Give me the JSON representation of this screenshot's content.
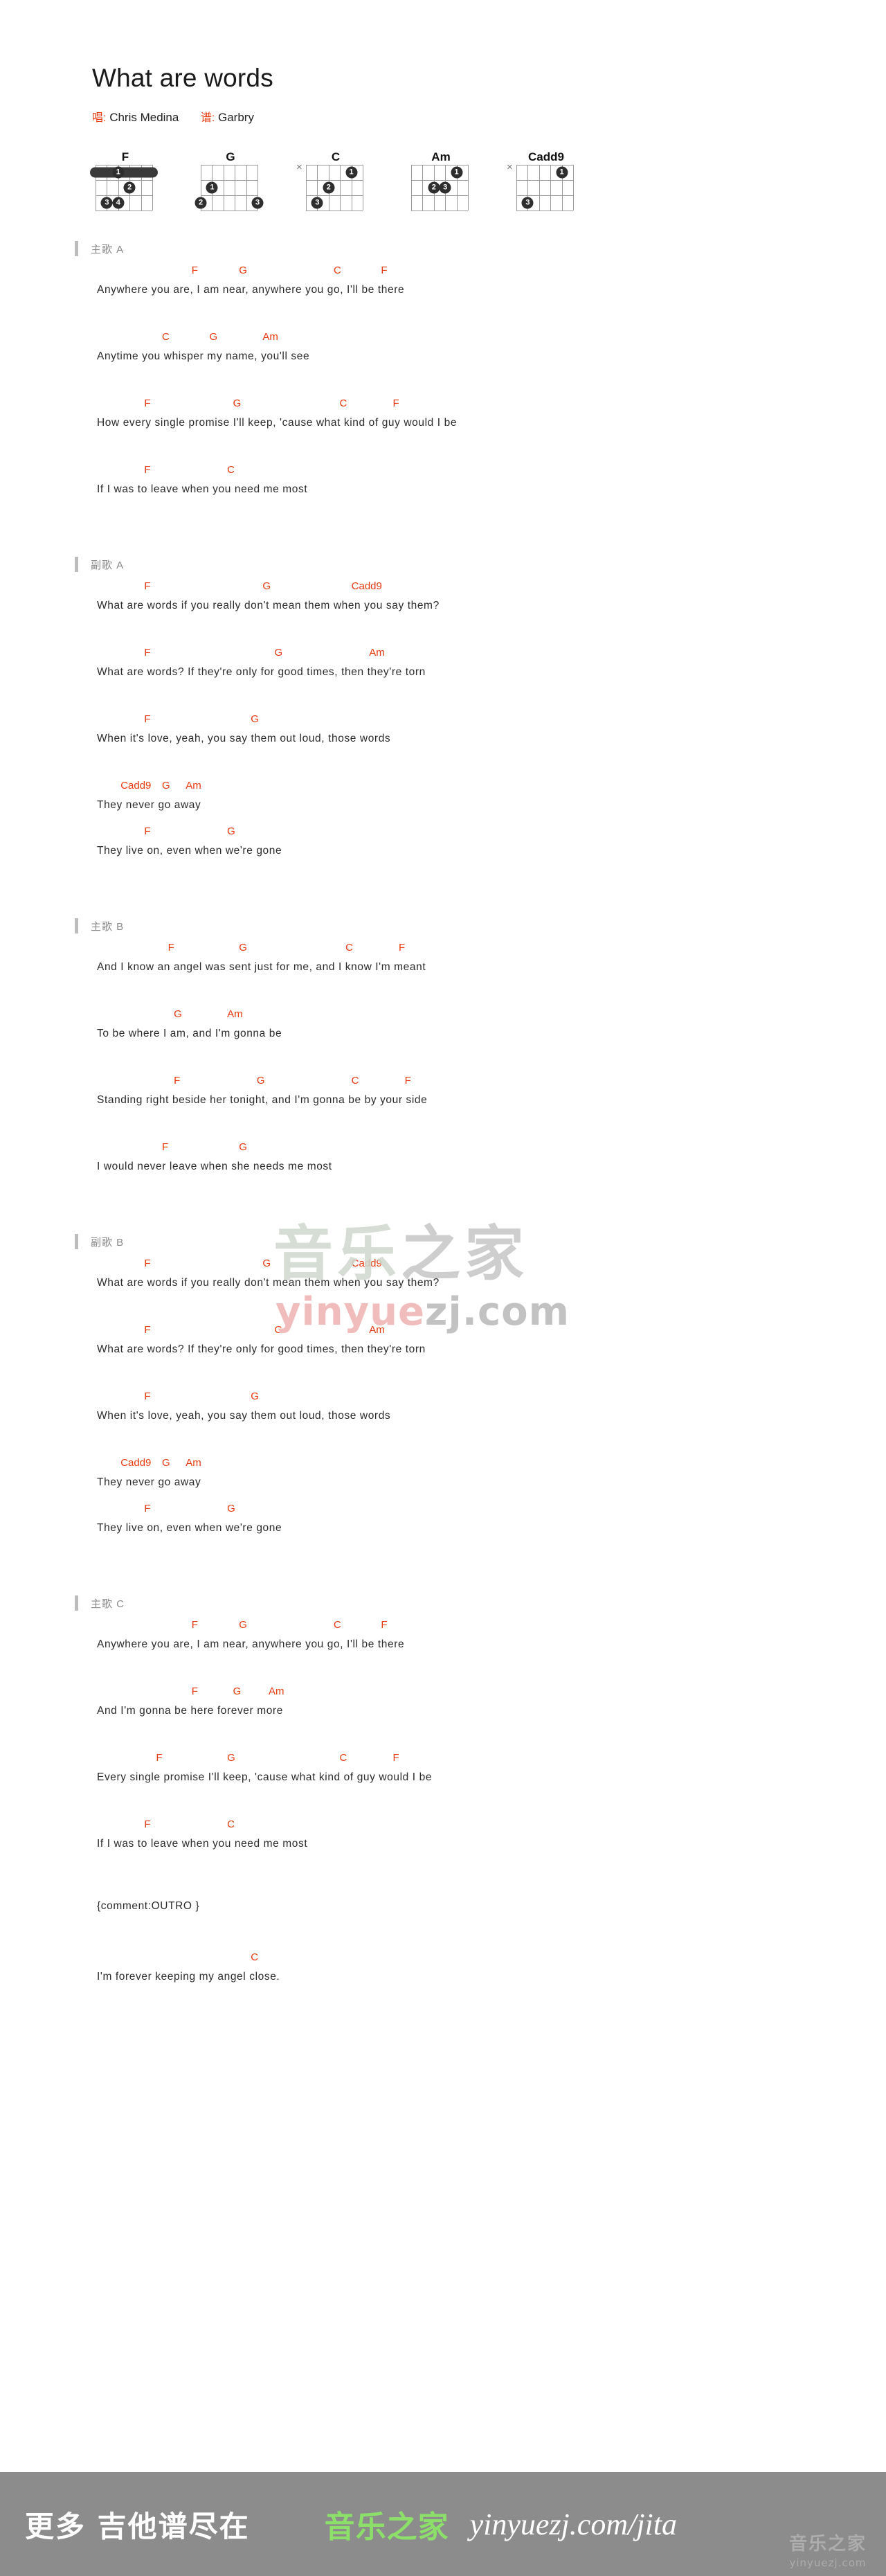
{
  "header": {
    "title": "What are words",
    "singer_label": "唱:",
    "singer": "Chris Medina",
    "transcriber_label": "谱:",
    "transcriber": "Garbry"
  },
  "chord_diagrams": [
    {
      "name": "F",
      "muted": "",
      "barre": {
        "fret": 1,
        "from_string": 1,
        "to_string": 6,
        "finger": "1"
      },
      "dots": [
        {
          "string": 3,
          "fret": 2,
          "finger": "2"
        },
        {
          "string": 5,
          "fret": 3,
          "finger": "3"
        },
        {
          "string": 4,
          "fret": 3,
          "finger": "4"
        }
      ]
    },
    {
      "name": "G",
      "muted": "",
      "barre": null,
      "dots": [
        {
          "string": 5,
          "fret": 2,
          "finger": "1"
        },
        {
          "string": 6,
          "fret": 3,
          "finger": "2"
        },
        {
          "string": 1,
          "fret": 3,
          "finger": "3"
        }
      ]
    },
    {
      "name": "C",
      "muted": "×",
      "barre": null,
      "dots": [
        {
          "string": 2,
          "fret": 1,
          "finger": "1"
        },
        {
          "string": 4,
          "fret": 2,
          "finger": "2"
        },
        {
          "string": 5,
          "fret": 3,
          "finger": "3"
        }
      ]
    },
    {
      "name": "Am",
      "muted": "",
      "barre": null,
      "dots": [
        {
          "string": 2,
          "fret": 1,
          "finger": "1"
        },
        {
          "string": 4,
          "fret": 2,
          "finger": "2"
        },
        {
          "string": 3,
          "fret": 2,
          "finger": "3"
        }
      ]
    },
    {
      "name": "Cadd9",
      "muted": "×",
      "barre": null,
      "dots": [
        {
          "string": 2,
          "fret": 1,
          "finger": "1"
        },
        {
          "string": 5,
          "fret": 3,
          "finger": "3"
        }
      ]
    }
  ],
  "sections": [
    {
      "label": "主歌 A",
      "lines": [
        {
          "chords": [
            {
              "name": "F",
              "col": 16
            },
            {
              "name": "G",
              "col": 24
            },
            {
              "name": "C",
              "col": 40
            },
            {
              "name": "F",
              "col": 48
            }
          ],
          "lyric": "Anywhere you are, I am near, anywhere you go, I'll be there"
        },
        {
          "chords": [
            {
              "name": "C",
              "col": 11
            },
            {
              "name": "G",
              "col": 19
            },
            {
              "name": "Am",
              "col": 28
            }
          ],
          "lyric": "Anytime you whisper my name, you'll see"
        },
        {
          "chords": [
            {
              "name": "F",
              "col": 8
            },
            {
              "name": "G",
              "col": 23
            },
            {
              "name": "C",
              "col": 41
            },
            {
              "name": "F",
              "col": 50
            }
          ],
          "lyric": "How every single promise I'll keep, 'cause what kind of guy would I be"
        },
        {
          "chords": [
            {
              "name": "F",
              "col": 8
            },
            {
              "name": "C",
              "col": 22
            }
          ],
          "lyric": "If I was to leave when you need me most"
        }
      ]
    },
    {
      "label": "副歌 A",
      "lines": [
        {
          "chords": [
            {
              "name": "F",
              "col": 8
            },
            {
              "name": "G",
              "col": 28
            },
            {
              "name": "Cadd9",
              "col": 43
            }
          ],
          "lyric": "What are words if you really don't mean them when you say them?"
        },
        {
          "chords": [
            {
              "name": "F",
              "col": 8
            },
            {
              "name": "G",
              "col": 30
            },
            {
              "name": "Am",
              "col": 46
            }
          ],
          "lyric": "What are words? If they're only for good times, then they're torn"
        },
        {
          "chords": [
            {
              "name": "F",
              "col": 8
            },
            {
              "name": "G",
              "col": 26
            }
          ],
          "lyric": "When it's love, yeah, you say them out loud, those words"
        },
        {
          "chords": [
            {
              "name": "Cadd9",
              "col": 4
            },
            {
              "name": "G",
              "col": 11
            },
            {
              "name": "Am",
              "col": 15
            }
          ],
          "lyric": "They never go away",
          "tight": true
        },
        {
          "chords": [
            {
              "name": "F",
              "col": 8
            },
            {
              "name": "G",
              "col": 22
            }
          ],
          "lyric": "They live on, even when we're gone"
        }
      ]
    },
    {
      "label": "主歌 B",
      "lines": [
        {
          "chords": [
            {
              "name": "F",
              "col": 12
            },
            {
              "name": "G",
              "col": 24
            },
            {
              "name": "C",
              "col": 42
            },
            {
              "name": "F",
              "col": 51
            }
          ],
          "lyric": "And I know an angel was sent just for me, and I know I'm meant"
        },
        {
          "chords": [
            {
              "name": "G",
              "col": 13
            },
            {
              "name": "Am",
              "col": 22
            }
          ],
          "lyric": "To be where I am, and I'm gonna be"
        },
        {
          "chords": [
            {
              "name": "F",
              "col": 13
            },
            {
              "name": "G",
              "col": 27
            },
            {
              "name": "C",
              "col": 43
            },
            {
              "name": "F",
              "col": 52
            }
          ],
          "lyric": "Standing right beside her tonight, and I'm gonna be by your side"
        },
        {
          "chords": [
            {
              "name": "F",
              "col": 11
            },
            {
              "name": "G",
              "col": 24
            }
          ],
          "lyric": "I would never leave when she needs me most"
        }
      ]
    },
    {
      "label": "副歌 B",
      "lines": [
        {
          "chords": [
            {
              "name": "F",
              "col": 8
            },
            {
              "name": "G",
              "col": 28
            },
            {
              "name": "Cadd9",
              "col": 43
            }
          ],
          "lyric": "What are words if you really don't mean them when you say them?"
        },
        {
          "chords": [
            {
              "name": "F",
              "col": 8
            },
            {
              "name": "G",
              "col": 30
            },
            {
              "name": "Am",
              "col": 46
            }
          ],
          "lyric": "What are words? If they're only for good times, then they're torn"
        },
        {
          "chords": [
            {
              "name": "F",
              "col": 8
            },
            {
              "name": "G",
              "col": 26
            }
          ],
          "lyric": "When it's love, yeah, you say them out loud, those words"
        },
        {
          "chords": [
            {
              "name": "Cadd9",
              "col": 4
            },
            {
              "name": "G",
              "col": 11
            },
            {
              "name": "Am",
              "col": 15
            }
          ],
          "lyric": "They never go away",
          "tight": true
        },
        {
          "chords": [
            {
              "name": "F",
              "col": 8
            },
            {
              "name": "G",
              "col": 22
            }
          ],
          "lyric": "They live on, even when we're gone"
        }
      ]
    },
    {
      "label": "主歌 C",
      "lines": [
        {
          "chords": [
            {
              "name": "F",
              "col": 16
            },
            {
              "name": "G",
              "col": 24
            },
            {
              "name": "C",
              "col": 40
            },
            {
              "name": "F",
              "col": 48
            }
          ],
          "lyric": "Anywhere you are, I am near, anywhere you go, I'll be there"
        },
        {
          "chords": [
            {
              "name": "F",
              "col": 16
            },
            {
              "name": "G",
              "col": 23
            },
            {
              "name": "Am",
              "col": 29
            }
          ],
          "lyric": "And I'm gonna be here forever more"
        },
        {
          "chords": [
            {
              "name": "F",
              "col": 10
            },
            {
              "name": "G",
              "col": 22
            },
            {
              "name": "C",
              "col": 41
            },
            {
              "name": "F",
              "col": 50
            }
          ],
          "lyric": "Every single promise I'll keep, 'cause what kind of guy would I be"
        },
        {
          "chords": [
            {
              "name": "F",
              "col": 8
            },
            {
              "name": "C",
              "col": 22
            }
          ],
          "lyric": "If I was to leave when you need me most"
        },
        {
          "chords": [],
          "lyric": "{comment:OUTRO }"
        },
        {
          "chords": [
            {
              "name": "C",
              "col": 26
            }
          ],
          "lyric": "I'm forever keeping my angel close."
        }
      ]
    }
  ],
  "watermark": {
    "cn_left": "音乐",
    "cn_right": "之家",
    "url_pink": "yinyue",
    "url_gray": "zj.com"
  },
  "footer": {
    "more_text": "更多 吉他谱尽在",
    "brand": "音乐之家",
    "url": "yinyuezj.com/jita",
    "logo_cn": "音乐之家",
    "logo_url": "yinyuezj.com"
  }
}
